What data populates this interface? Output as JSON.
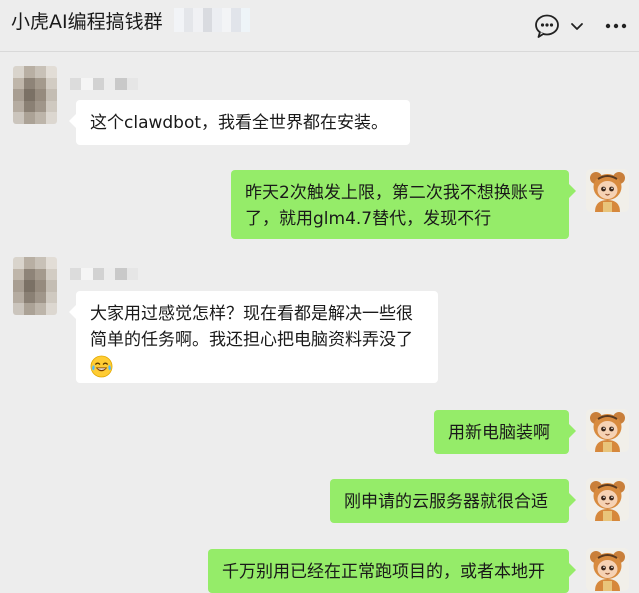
{
  "header": {
    "title": "小虎AI编程搞钱群",
    "icons": {
      "chat": "chat-bubble-icon",
      "expand": "chevron-down-icon",
      "more": "more-icon"
    }
  },
  "messages": [
    {
      "side": "left",
      "lines": [
        "这个clawdbot，我看全世界都在安装。"
      ]
    },
    {
      "side": "right",
      "lines": [
        "昨天2次触发上限，第二次我不想换账号",
        "了，就用glm4.7替代，发现不行"
      ]
    },
    {
      "side": "left",
      "lines": [
        "大家用过感觉怎样？现在看都是解决一些很",
        "简单的任务啊。我还担心把电脑资料弄没了"
      ],
      "emoji": "tears-of-joy-emoji"
    },
    {
      "side": "right",
      "lines": [
        "用新电脑装啊"
      ]
    },
    {
      "side": "right",
      "lines": [
        "刚申请的云服务器就很合适"
      ]
    },
    {
      "side": "right",
      "lines": [
        "千万别用已经在正常跑项目的，或者本地开"
      ]
    }
  ],
  "colors": {
    "background": "#ededed",
    "self_bubble": "#95ec69",
    "other_bubble": "#ffffff"
  }
}
